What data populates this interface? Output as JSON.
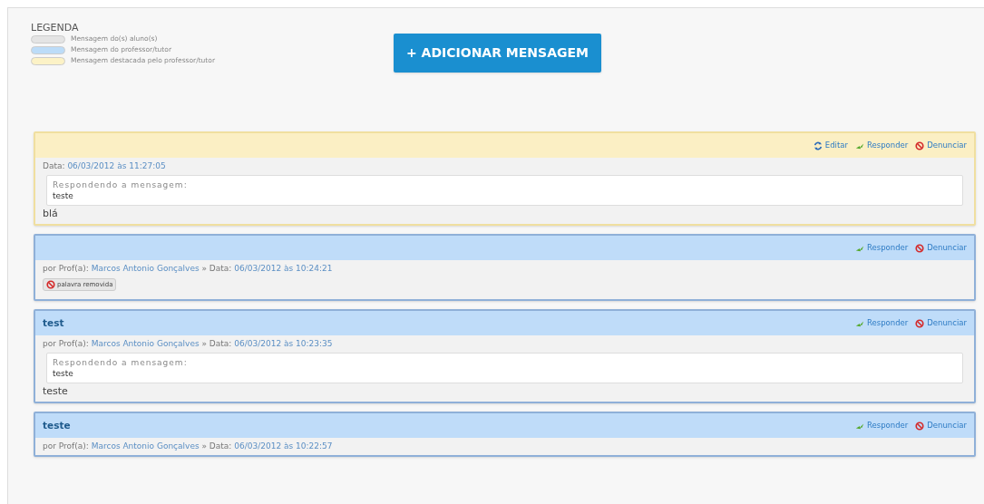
{
  "legend": {
    "title": "LEGENDA",
    "items": [
      {
        "label": "Mensagem do(s) aluno(s)",
        "color": "#e4e4e4"
      },
      {
        "label": "Mensagem do professor/tutor",
        "color": "#bcdcf8"
      },
      {
        "label": "Mensagem destacada pelo professor/tutor",
        "color": "#fcf2c6"
      }
    ]
  },
  "add_button": "+ ADICIONAR MENSAGEM",
  "messages": [
    {
      "kind": "highlighted",
      "actions": [
        {
          "kind": "edit",
          "label": "Editar"
        },
        {
          "kind": "reply",
          "label": "Responder"
        },
        {
          "kind": "report",
          "label": "Denunciar"
        }
      ],
      "date_label": "Data:",
      "date": "06/03/2012 às 11:27:05",
      "quote": {
        "label": "Respondendo a mensagem:",
        "text": "teste"
      },
      "body": "blá"
    },
    {
      "kind": "professor",
      "actions": [
        {
          "kind": "reply",
          "label": "Responder"
        },
        {
          "kind": "report",
          "label": "Denunciar"
        }
      ],
      "author_prefix": "por Prof(a):",
      "author": "Marcos Antonio Gonçalves",
      "date_label": "» Data:",
      "date": "06/03/2012 às 10:24:21",
      "removed": "palavra removida"
    },
    {
      "kind": "professor",
      "title": "test",
      "actions": [
        {
          "kind": "reply",
          "label": "Responder"
        },
        {
          "kind": "report",
          "label": "Denunciar"
        }
      ],
      "author_prefix": "por Prof(a):",
      "author": "Marcos Antonio Gonçalves",
      "date_label": "» Data:",
      "date": "06/03/2012 às 10:23:35",
      "quote": {
        "label": "Respondendo a mensagem:",
        "text": "teste"
      },
      "body": "teste"
    },
    {
      "kind": "professor",
      "title": "teste",
      "actions": [
        {
          "kind": "reply",
          "label": "Responder"
        },
        {
          "kind": "report",
          "label": "Denunciar"
        }
      ],
      "author_prefix": "por Prof(a):",
      "author": "Marcos Antonio Gonçalves",
      "date_label": "» Data:",
      "date": "06/03/2012 às 10:22:57"
    }
  ]
}
